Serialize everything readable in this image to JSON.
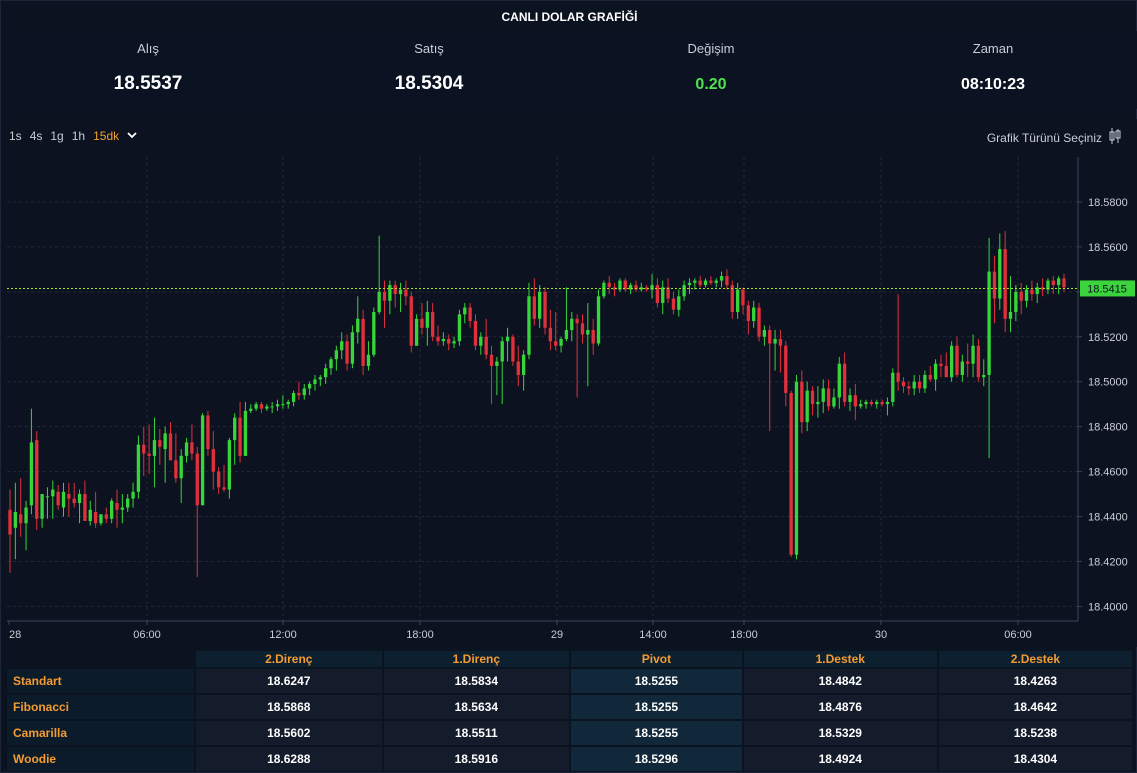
{
  "header": {
    "title": "CANLI DOLAR GRAFİĞİ"
  },
  "stats": [
    {
      "label": "Alış",
      "value": "18.5537"
    },
    {
      "label": "Satış",
      "value": "18.5304"
    },
    {
      "label": "Değişim",
      "value": "0.20"
    },
    {
      "label": "Zaman",
      "value": "08:10:23"
    }
  ],
  "timeframes": {
    "items": [
      "1s",
      "4s",
      "1g",
      "1h"
    ],
    "active": "15dk"
  },
  "chart_type_label": "Grafik Türünü Seçiniz",
  "colors": {
    "up": "#36d63a",
    "down": "#e0303c",
    "price_line": "#a8e51a",
    "accent": "#f39c32"
  },
  "chart_data": {
    "type": "candlestick",
    "title": "",
    "y_ticks": [
      "18.5800",
      "18.5600",
      "18.5400",
      "18.5200",
      "18.5000",
      "18.4800",
      "18.4600",
      "18.4400",
      "18.4200",
      "18.4000"
    ],
    "ylim": [
      18.3935,
      18.6
    ],
    "x_ticks": [
      "28",
      "06:00",
      "12:00",
      "18:00",
      "29",
      "14:00",
      "18:00",
      "30",
      "06:00"
    ],
    "last_price": "18.5415",
    "grid": true,
    "candles": [
      [
        18.443,
        18.452,
        18.415,
        18.432
      ],
      [
        18.435,
        18.455,
        18.421,
        18.442
      ],
      [
        18.441,
        18.457,
        18.431,
        18.437
      ],
      [
        18.437,
        18.447,
        18.425,
        18.444
      ],
      [
        18.445,
        18.488,
        18.441,
        18.473
      ],
      [
        18.474,
        18.478,
        18.434,
        18.439
      ],
      [
        18.439,
        18.45,
        18.435,
        18.45
      ],
      [
        18.449,
        18.453,
        18.439,
        18.449
      ],
      [
        18.449,
        18.456,
        18.439,
        18.452
      ],
      [
        18.451,
        18.454,
        18.443,
        18.445
      ],
      [
        18.444,
        18.455,
        18.44,
        18.451
      ],
      [
        18.45,
        18.455,
        18.44,
        18.448
      ],
      [
        18.448,
        18.455,
        18.444,
        18.446
      ],
      [
        18.446,
        18.452,
        18.437,
        18.45
      ],
      [
        18.45,
        18.456,
        18.439,
        18.438
      ],
      [
        18.438,
        18.447,
        18.436,
        18.443
      ],
      [
        18.442,
        18.451,
        18.435,
        18.437
      ],
      [
        18.437,
        18.441,
        18.436,
        18.441
      ],
      [
        18.441,
        18.444,
        18.437,
        18.439
      ],
      [
        18.439,
        18.448,
        18.437,
        18.447
      ],
      [
        18.446,
        18.452,
        18.435,
        18.443
      ],
      [
        18.443,
        18.45,
        18.437,
        18.444
      ],
      [
        18.444,
        18.45,
        18.442,
        18.448
      ],
      [
        18.448,
        18.455,
        18.444,
        18.451
      ],
      [
        18.451,
        18.476,
        18.448,
        18.472
      ],
      [
        18.472,
        18.48,
        18.458,
        18.468
      ],
      [
        18.468,
        18.481,
        18.459,
        18.467
      ],
      [
        18.467,
        18.484,
        18.453,
        18.474
      ],
      [
        18.474,
        18.479,
        18.463,
        18.471
      ],
      [
        18.47,
        18.48,
        18.455,
        18.477
      ],
      [
        18.477,
        18.482,
        18.467,
        18.465
      ],
      [
        18.465,
        18.477,
        18.455,
        18.457
      ],
      [
        18.457,
        18.47,
        18.446,
        18.467
      ],
      [
        18.467,
        18.475,
        18.464,
        18.473
      ],
      [
        18.473,
        18.481,
        18.465,
        18.468
      ],
      [
        18.468,
        18.471,
        18.413,
        18.445
      ],
      [
        18.445,
        18.486,
        18.445,
        18.485
      ],
      [
        18.485,
        18.487,
        18.467,
        18.47
      ],
      [
        18.47,
        18.478,
        18.452,
        18.46
      ],
      [
        18.46,
        18.462,
        18.45,
        18.453
      ],
      [
        18.453,
        18.463,
        18.451,
        18.452
      ],
      [
        18.452,
        18.475,
        18.448,
        18.474
      ],
      [
        18.474,
        18.486,
        18.463,
        18.484
      ],
      [
        18.484,
        18.491,
        18.464,
        18.467
      ],
      [
        18.467,
        18.491,
        18.467,
        18.487
      ],
      [
        18.487,
        18.49,
        18.486,
        18.488
      ],
      [
        18.488,
        18.491,
        18.487,
        18.49
      ],
      [
        18.49,
        18.491,
        18.486,
        18.488
      ],
      [
        18.488,
        18.49,
        18.487,
        18.489
      ],
      [
        18.489,
        18.491,
        18.486,
        18.489
      ],
      [
        18.489,
        18.492,
        18.487,
        18.49
      ],
      [
        18.49,
        18.494,
        18.488,
        18.49
      ],
      [
        18.49,
        18.492,
        18.488,
        18.491
      ],
      [
        18.491,
        18.496,
        18.489,
        18.495
      ],
      [
        18.495,
        18.5,
        18.492,
        18.494
      ],
      [
        18.494,
        18.499,
        18.492,
        18.497
      ],
      [
        18.497,
        18.5,
        18.494,
        18.499
      ],
      [
        18.499,
        18.503,
        18.496,
        18.501
      ],
      [
        18.501,
        18.503,
        18.498,
        18.502
      ],
      [
        18.502,
        18.508,
        18.499,
        18.506
      ],
      [
        18.506,
        18.511,
        18.503,
        18.51
      ],
      [
        18.51,
        18.516,
        18.505,
        18.514
      ],
      [
        18.514,
        18.522,
        18.51,
        18.518
      ],
      [
        18.518,
        18.521,
        18.505,
        18.508
      ],
      [
        18.508,
        18.525,
        18.506,
        18.522
      ],
      [
        18.522,
        18.538,
        18.517,
        18.528
      ],
      [
        18.528,
        18.532,
        18.503,
        18.507
      ],
      [
        18.507,
        18.518,
        18.505,
        18.512
      ],
      [
        18.512,
        18.533,
        18.511,
        18.531
      ],
      [
        18.531,
        18.565,
        18.53,
        18.54
      ],
      [
        18.54,
        18.545,
        18.524,
        18.536
      ],
      [
        18.536,
        18.545,
        18.53,
        18.543
      ],
      [
        18.543,
        18.545,
        18.533,
        18.539
      ],
      [
        18.539,
        18.544,
        18.531,
        18.541
      ],
      [
        18.541,
        18.545,
        18.534,
        18.538
      ],
      [
        18.538,
        18.54,
        18.513,
        18.516
      ],
      [
        18.516,
        18.53,
        18.516,
        18.528
      ],
      [
        18.528,
        18.535,
        18.521,
        18.524
      ],
      [
        18.524,
        18.536,
        18.516,
        18.531
      ],
      [
        18.531,
        18.535,
        18.518,
        18.52
      ],
      [
        18.52,
        18.525,
        18.516,
        18.518
      ],
      [
        18.518,
        18.522,
        18.516,
        18.519
      ],
      [
        18.519,
        18.521,
        18.514,
        18.517
      ],
      [
        18.517,
        18.52,
        18.515,
        18.518
      ],
      [
        18.518,
        18.532,
        18.516,
        18.53
      ],
      [
        18.53,
        18.535,
        18.526,
        18.533
      ],
      [
        18.533,
        18.535,
        18.524,
        18.527
      ],
      [
        18.527,
        18.53,
        18.514,
        18.516
      ],
      [
        18.516,
        18.522,
        18.512,
        18.52
      ],
      [
        18.52,
        18.528,
        18.51,
        18.512
      ],
      [
        18.512,
        18.516,
        18.49,
        18.507
      ],
      [
        18.507,
        18.511,
        18.494,
        18.509
      ],
      [
        18.509,
        18.52,
        18.49,
        18.518
      ],
      [
        18.518,
        18.524,
        18.509,
        18.52
      ],
      [
        18.52,
        18.521,
        18.507,
        18.509
      ],
      [
        18.509,
        18.516,
        18.498,
        18.503
      ],
      [
        18.503,
        18.514,
        18.496,
        18.512
      ],
      [
        18.512,
        18.544,
        18.51,
        18.538
      ],
      [
        18.538,
        18.546,
        18.525,
        18.528
      ],
      [
        18.528,
        18.543,
        18.524,
        18.54
      ],
      [
        18.54,
        18.542,
        18.521,
        18.524
      ],
      [
        18.524,
        18.532,
        18.514,
        18.518
      ],
      [
        18.518,
        18.531,
        18.514,
        18.516
      ],
      [
        18.516,
        18.52,
        18.513,
        18.519
      ],
      [
        18.519,
        18.542,
        18.518,
        18.523
      ],
      [
        18.523,
        18.531,
        18.518,
        18.528
      ],
      [
        18.528,
        18.53,
        18.493,
        18.526
      ],
      [
        18.526,
        18.53,
        18.517,
        18.521
      ],
      [
        18.521,
        18.535,
        18.498,
        18.523
      ],
      [
        18.523,
        18.528,
        18.512,
        18.517
      ],
      [
        18.517,
        18.541,
        18.516,
        18.538
      ],
      [
        18.538,
        18.545,
        18.537,
        18.544
      ],
      [
        18.544,
        18.547,
        18.539,
        18.542
      ],
      [
        18.542,
        18.544,
        18.538,
        18.541
      ],
      [
        18.541,
        18.546,
        18.54,
        18.545
      ],
      [
        18.545,
        18.546,
        18.54,
        18.541
      ],
      [
        18.541,
        18.544,
        18.539,
        18.543
      ],
      [
        18.543,
        18.545,
        18.54,
        18.541
      ],
      [
        18.541,
        18.544,
        18.54,
        18.542
      ],
      [
        18.542,
        18.543,
        18.54,
        18.541
      ],
      [
        18.541,
        18.548,
        18.537,
        18.543
      ],
      [
        18.543,
        18.546,
        18.533,
        18.535
      ],
      [
        18.535,
        18.545,
        18.53,
        18.542
      ],
      [
        18.542,
        18.546,
        18.535,
        18.537
      ],
      [
        18.537,
        18.54,
        18.53,
        18.532
      ],
      [
        18.532,
        18.541,
        18.529,
        18.538
      ],
      [
        18.538,
        18.545,
        18.536,
        18.543
      ],
      [
        18.543,
        18.546,
        18.539,
        18.544
      ],
      [
        18.544,
        18.546,
        18.541,
        18.545
      ],
      [
        18.545,
        18.547,
        18.542,
        18.543
      ],
      [
        18.543,
        18.546,
        18.542,
        18.545
      ],
      [
        18.545,
        18.547,
        18.543,
        18.544
      ],
      [
        18.544,
        18.546,
        18.542,
        18.545
      ],
      [
        18.545,
        18.549,
        18.542,
        18.547
      ],
      [
        18.547,
        18.55,
        18.541,
        18.543
      ],
      [
        18.543,
        18.545,
        18.528,
        18.531
      ],
      [
        18.531,
        18.544,
        18.528,
        18.541
      ],
      [
        18.541,
        18.542,
        18.53,
        18.534
      ],
      [
        18.534,
        18.536,
        18.521,
        18.527
      ],
      [
        18.527,
        18.536,
        18.524,
        18.533
      ],
      [
        18.533,
        18.535,
        18.518,
        18.52
      ],
      [
        18.52,
        18.525,
        18.516,
        18.523
      ],
      [
        18.523,
        18.525,
        18.478,
        18.517
      ],
      [
        18.517,
        18.523,
        18.505,
        18.519
      ],
      [
        18.519,
        18.523,
        18.504,
        18.516
      ],
      [
        18.516,
        18.518,
        18.489,
        18.495
      ],
      [
        18.495,
        18.496,
        18.422,
        18.423
      ],
      [
        18.423,
        18.503,
        18.421,
        18.5
      ],
      [
        18.5,
        18.505,
        18.477,
        18.482
      ],
      [
        18.482,
        18.5,
        18.478,
        18.496
      ],
      [
        18.496,
        18.498,
        18.485,
        18.49
      ],
      [
        18.49,
        18.498,
        18.484,
        18.491
      ],
      [
        18.491,
        18.501,
        18.486,
        18.497
      ],
      [
        18.497,
        18.501,
        18.487,
        18.489
      ],
      [
        18.489,
        18.497,
        18.488,
        18.493
      ],
      [
        18.493,
        18.511,
        18.488,
        18.508
      ],
      [
        18.508,
        18.513,
        18.489,
        18.491
      ],
      [
        18.491,
        18.497,
        18.487,
        18.494
      ],
      [
        18.494,
        18.499,
        18.483,
        18.489
      ],
      [
        18.489,
        18.492,
        18.488,
        18.49
      ],
      [
        18.49,
        18.492,
        18.488,
        18.491
      ],
      [
        18.491,
        18.492,
        18.489,
        18.49
      ],
      [
        18.49,
        18.492,
        18.488,
        18.491
      ],
      [
        18.491,
        18.492,
        18.489,
        18.49
      ],
      [
        18.49,
        18.493,
        18.485,
        18.491
      ],
      [
        18.491,
        18.506,
        18.489,
        18.504
      ],
      [
        18.504,
        18.539,
        18.496,
        18.5
      ],
      [
        18.5,
        18.502,
        18.495,
        18.498
      ],
      [
        18.498,
        18.5,
        18.494,
        18.497
      ],
      [
        18.497,
        18.503,
        18.494,
        18.5
      ],
      [
        18.5,
        18.503,
        18.495,
        18.497
      ],
      [
        18.497,
        18.505,
        18.495,
        18.503
      ],
      [
        18.503,
        18.507,
        18.5,
        18.501
      ],
      [
        18.501,
        18.51,
        18.496,
        18.508
      ],
      [
        18.508,
        18.512,
        18.502,
        18.507
      ],
      [
        18.507,
        18.513,
        18.504,
        18.502
      ],
      [
        18.502,
        18.518,
        18.5,
        18.516
      ],
      [
        18.516,
        18.52,
        18.502,
        18.503
      ],
      [
        18.503,
        18.512,
        18.5,
        18.509
      ],
      [
        18.509,
        18.517,
        18.502,
        18.508
      ],
      [
        18.508,
        18.521,
        18.502,
        18.516
      ],
      [
        18.516,
        18.519,
        18.5,
        18.502
      ],
      [
        18.502,
        18.51,
        18.498,
        18.503
      ],
      [
        18.503,
        18.564,
        18.466,
        18.549
      ],
      [
        18.549,
        18.556,
        18.526,
        18.537
      ],
      [
        18.537,
        18.566,
        18.532,
        18.559
      ],
      [
        18.559,
        18.567,
        18.522,
        18.528
      ],
      [
        18.528,
        18.547,
        18.522,
        18.531
      ],
      [
        18.531,
        18.543,
        18.527,
        18.54
      ],
      [
        18.54,
        18.544,
        18.53,
        18.536
      ],
      [
        18.536,
        18.543,
        18.533,
        18.541
      ],
      [
        18.541,
        18.545,
        18.536,
        18.539
      ],
      [
        18.539,
        18.544,
        18.535,
        18.542
      ],
      [
        18.542,
        18.546,
        18.538,
        18.541
      ],
      [
        18.541,
        18.546,
        18.539,
        18.545
      ],
      [
        18.545,
        18.547,
        18.539,
        18.543
      ],
      [
        18.543,
        18.547,
        18.539,
        18.546
      ],
      [
        18.546,
        18.548,
        18.54,
        18.542
      ]
    ]
  },
  "pivot_table": {
    "headers": [
      "2.Direnç",
      "1.Direnç",
      "Pivot",
      "1.Destek",
      "2.Destek"
    ],
    "rows": [
      {
        "name": "Standart",
        "values": [
          "18.6247",
          "18.5834",
          "18.5255",
          "18.4842",
          "18.4263"
        ]
      },
      {
        "name": "Fibonacci",
        "values": [
          "18.5868",
          "18.5634",
          "18.5255",
          "18.4876",
          "18.4642"
        ]
      },
      {
        "name": "Camarilla",
        "values": [
          "18.5602",
          "18.5511",
          "18.5255",
          "18.5329",
          "18.5238"
        ]
      },
      {
        "name": "Woodie",
        "values": [
          "18.6288",
          "18.5916",
          "18.5296",
          "18.4924",
          "18.4304"
        ]
      }
    ]
  }
}
